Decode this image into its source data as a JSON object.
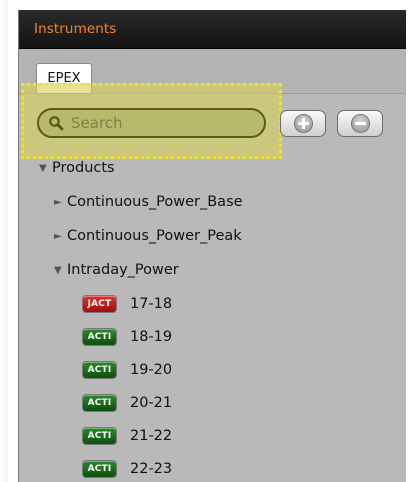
{
  "panel": {
    "title": "Instruments",
    "tabs": [
      {
        "label": "EPEX",
        "active": true
      }
    ]
  },
  "toolbar": {
    "search_placeholder": "Search",
    "search_value": "",
    "add_icon": "plus-circle-icon",
    "remove_icon": "minus-circle-icon"
  },
  "tree": {
    "root": {
      "label": "Products",
      "expanded": true
    },
    "groups": [
      {
        "label": "Continuous_Power_Base",
        "expanded": false
      },
      {
        "label": "Continuous_Power_Peak",
        "expanded": false
      },
      {
        "label": "Intraday_Power",
        "expanded": true
      }
    ],
    "items": [
      {
        "badge": "JACT",
        "label": "17-18",
        "badge_color": "#c81414"
      },
      {
        "badge": "ACTI",
        "label": "18-19",
        "badge_color": "#1a6a1a"
      },
      {
        "badge": "ACTI",
        "label": "19-20",
        "badge_color": "#1a6a1a"
      },
      {
        "badge": "ACTI",
        "label": "20-21",
        "badge_color": "#1a6a1a"
      },
      {
        "badge": "ACTI",
        "label": "21-22",
        "badge_color": "#1a6a1a"
      },
      {
        "badge": "ACTI",
        "label": "22-23",
        "badge_color": "#1a6a1a"
      }
    ]
  },
  "colors": {
    "header_text": "#f08a28",
    "panel_bg": "#b9b9b9",
    "highlight": "#f2ea00"
  }
}
